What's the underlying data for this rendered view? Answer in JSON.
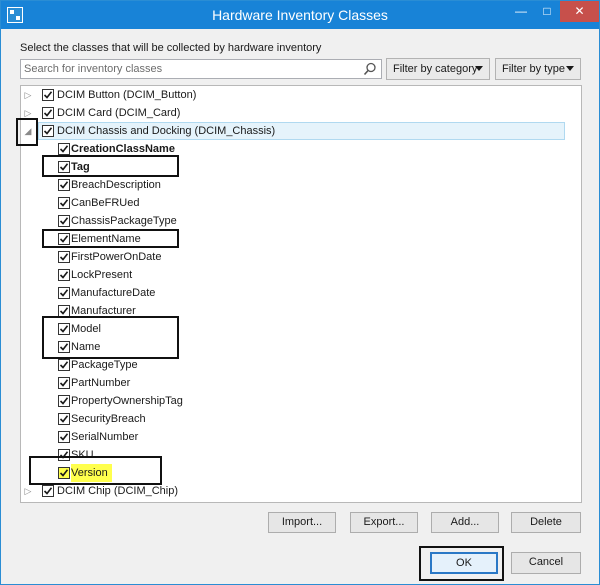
{
  "window": {
    "title": "Hardware Inventory Classes"
  },
  "instructions": "Select the classes that will be collected by hardware inventory",
  "search": {
    "placeholder": "Search for inventory classes",
    "value": ""
  },
  "filters": {
    "by_category": "Filter by category",
    "by_type": "Filter by type"
  },
  "tree": {
    "classes_before": [
      {
        "label": "DCIM Button (DCIM_Button)",
        "checked": true,
        "expanded": false
      },
      {
        "label": "DCIM Card (DCIM_Card)",
        "checked": true,
        "expanded": false
      }
    ],
    "expanded_class": {
      "label": "DCIM Chassis and Docking (DCIM_Chassis)",
      "checked": true,
      "expanded": true
    },
    "properties": [
      {
        "label": "CreationClassName",
        "checked": true,
        "bold": true
      },
      {
        "label": "Tag",
        "checked": true,
        "bold": true
      },
      {
        "label": "BreachDescription",
        "checked": true
      },
      {
        "label": "CanBeFRUed",
        "checked": true
      },
      {
        "label": "ChassisPackageType",
        "checked": true
      },
      {
        "label": "ElementName",
        "checked": true
      },
      {
        "label": "FirstPowerOnDate",
        "checked": true
      },
      {
        "label": "LockPresent",
        "checked": true
      },
      {
        "label": "ManufactureDate",
        "checked": true
      },
      {
        "label": "Manufacturer",
        "checked": true
      },
      {
        "label": "Model",
        "checked": true
      },
      {
        "label": "Name",
        "checked": true
      },
      {
        "label": "PackageType",
        "checked": true
      },
      {
        "label": "PartNumber",
        "checked": true
      },
      {
        "label": "PropertyOwnershipTag",
        "checked": true
      },
      {
        "label": "SecurityBreach",
        "checked": true
      },
      {
        "label": "SerialNumber",
        "checked": true
      },
      {
        "label": "SKU",
        "checked": true
      },
      {
        "label": "Version",
        "checked": true,
        "highlight": "#ffff4d"
      }
    ],
    "classes_after": [
      {
        "label": "DCIM Chip (DCIM_Chip)",
        "checked": true,
        "expanded": false
      }
    ]
  },
  "buttons": {
    "import": "Import...",
    "export": "Export...",
    "add": "Add...",
    "delete": "Delete",
    "ok": "OK",
    "cancel": "Cancel"
  },
  "colors": {
    "titlebar": "#1883d7",
    "close": "#c7504b",
    "highlight": "#ffff4d",
    "selection": "#e5f3fb"
  }
}
